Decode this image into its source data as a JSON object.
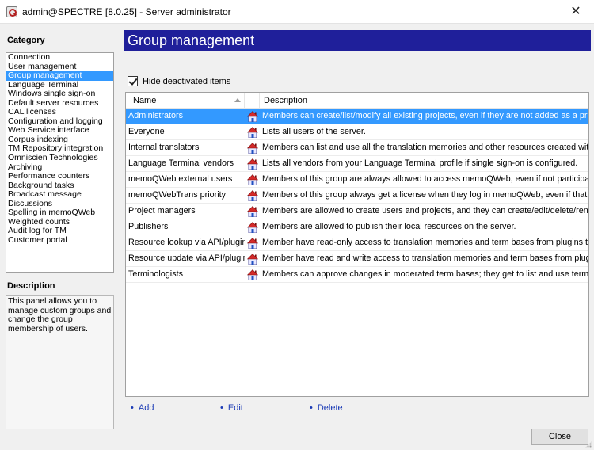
{
  "window": {
    "title": "admin@SPECTRE [8.0.25] - Server administrator",
    "close_glyph": "✕"
  },
  "sidebar": {
    "category_header": "Category",
    "selected_index": 2,
    "items": [
      "Connection",
      "User management",
      "Group management",
      "Language Terminal",
      "Windows single sign-on",
      "Default server resources",
      "CAL licenses",
      "Configuration and logging",
      "Web Service interface",
      "Corpus indexing",
      "TM Repository integration",
      "Omniscien Technologies",
      "Archiving",
      "Performance counters",
      "Background tasks",
      "Broadcast message",
      "Discussions",
      "Spelling in memoQWeb",
      "Weighted counts",
      "Audit log for TM",
      "Customer portal"
    ],
    "description_header": "Description",
    "description_text": "This panel allows you to manage custom groups and change the group membership of users."
  },
  "main": {
    "page_title": "Group management",
    "hide_deactivated_label": "Hide deactivated items",
    "hide_deactivated_checked": true,
    "table": {
      "columns": [
        "Name",
        "Description"
      ],
      "sort_column": "Name",
      "sort_direction": "ascending",
      "selected_index": 0,
      "row_icon": "group-house-icon",
      "rows": [
        {
          "name": "Administrators",
          "description": "Members can create/list/modify all existing projects, even if they are not added as a project ..."
        },
        {
          "name": "Everyone",
          "description": "Lists all users of the server."
        },
        {
          "name": "Internal translators",
          "description": "Members can list and use all the translation memories and other resources created with defau..."
        },
        {
          "name": "Language Terminal vendors",
          "description": "Lists all vendors from your Language Terminal profile if single sign-on is configured."
        },
        {
          "name": "memoQWeb external users",
          "description": "Members of this group are always allowed to access memoQWeb, even if not participating in ..."
        },
        {
          "name": "memoQWebTrans priority",
          "description": "Members of this group always get a license when they log in memoQWeb, even if that means..."
        },
        {
          "name": "Project managers",
          "description": "Members are allowed to create users and projects, and they can create/edit/delete/rename ..."
        },
        {
          "name": "Publishers",
          "description": "Members are allowed to publish their local resources on the server."
        },
        {
          "name": "Resource lookup via API/plugins",
          "description": "Member have read-only access to translation memories and term bases from plugins that use ..."
        },
        {
          "name": "Resource update via API/plugins",
          "description": "Member have read and write access to translation memories and term bases from plugins that..."
        },
        {
          "name": "Terminologists",
          "description": "Members can approve changes in moderated term bases; they get to list and use term bases ..."
        }
      ]
    },
    "actions": {
      "bullet": "•",
      "add": "Add",
      "edit": "Edit",
      "delete": "Delete"
    },
    "close_button": {
      "underlined": "C",
      "rest": "lose"
    }
  },
  "colors": {
    "title_bar": "#1f1f9a",
    "selection": "#3399ff",
    "link": "#1a3ab5"
  }
}
